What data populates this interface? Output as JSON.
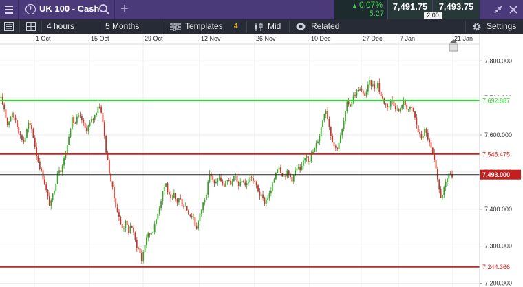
{
  "header": {
    "instrument_number": "1",
    "instrument_name": "UK 100 - Cash",
    "change_percent": "0.07%",
    "change_points": "5.27",
    "sell_price": "7,491.75",
    "buy_price": "7,493.75",
    "spread": "2.00",
    "colors": {
      "bar": "#4a3a7a",
      "change_up": "#3ed14a"
    }
  },
  "toolbar": {
    "interval": "4 hours",
    "range": "5 Months",
    "templates_label": "Templates",
    "templates_count": "4",
    "price_type": "Mid",
    "related_label": "Related",
    "settings_label": "Settings"
  },
  "chart_data": {
    "type": "candlestick",
    "x_ticks": [
      "1 Oct",
      "15 Oct",
      "29 Oct",
      "12 Nov",
      "26 Nov",
      "10 Dec",
      "27 Dec",
      "7 Jan",
      "21 Jan"
    ],
    "y_ticks": [
      "7,800.000",
      "7,700.000",
      "7,600.000",
      "7,500.000",
      "7,400.000",
      "7,300.000",
      "7,200.000"
    ],
    "ylim": [
      7190,
      7845
    ],
    "up_color": "#3aa12a",
    "down_color": "#c0392b",
    "levels": [
      {
        "label": "7,692.887",
        "value": 7692.887,
        "color": "#22e022"
      },
      {
        "label": "7,548.475",
        "value": 7548.475,
        "color": "#d11f1f"
      },
      {
        "label": "7,493.000",
        "value": 7493.0,
        "color": "#222222"
      },
      {
        "label": "7,244.366",
        "value": 7244.366,
        "color": "#d11f1f"
      }
    ],
    "price_path": [
      [
        0,
        7700
      ],
      [
        5,
        7672
      ],
      [
        10,
        7628
      ],
      [
        16,
        7658
      ],
      [
        22,
        7640
      ],
      [
        28,
        7600
      ],
      [
        34,
        7580
      ],
      [
        40,
        7630
      ],
      [
        46,
        7612
      ],
      [
        52,
        7548
      ],
      [
        58,
        7508
      ],
      [
        63,
        7478
      ],
      [
        68,
        7435
      ],
      [
        72,
        7405
      ],
      [
        76,
        7440
      ],
      [
        80,
        7470
      ],
      [
        84,
        7512
      ],
      [
        88,
        7505
      ],
      [
        92,
        7535
      ],
      [
        96,
        7560
      ],
      [
        100,
        7612
      ],
      [
        104,
        7642
      ],
      [
        108,
        7628
      ],
      [
        112,
        7650
      ],
      [
        118,
        7640
      ],
      [
        124,
        7612
      ],
      [
        130,
        7632
      ],
      [
        136,
        7648
      ],
      [
        142,
        7680
      ],
      [
        146,
        7668
      ],
      [
        150,
        7612
      ],
      [
        154,
        7545
      ],
      [
        158,
        7500
      ],
      [
        162,
        7460
      ],
      [
        166,
        7420
      ],
      [
        170,
        7392
      ],
      [
        174,
        7362
      ],
      [
        178,
        7348
      ],
      [
        182,
        7365
      ],
      [
        186,
        7340
      ],
      [
        190,
        7360
      ],
      [
        194,
        7325
      ],
      [
        198,
        7300
      ],
      [
        202,
        7288
      ],
      [
        205,
        7262
      ],
      [
        208,
        7292
      ],
      [
        212,
        7325
      ],
      [
        216,
        7332
      ],
      [
        220,
        7340
      ],
      [
        224,
        7355
      ],
      [
        228,
        7390
      ],
      [
        232,
        7415
      ],
      [
        236,
        7455
      ],
      [
        240,
        7470
      ],
      [
        244,
        7438
      ],
      [
        248,
        7420
      ],
      [
        252,
        7438
      ],
      [
        256,
        7418
      ],
      [
        260,
        7432
      ],
      [
        264,
        7412
      ],
      [
        268,
        7410
      ],
      [
        272,
        7395
      ],
      [
        276,
        7382
      ],
      [
        280,
        7380
      ],
      [
        284,
        7345
      ],
      [
        288,
        7372
      ],
      [
        292,
        7400
      ],
      [
        296,
        7428
      ],
      [
        300,
        7452
      ],
      [
        304,
        7502
      ],
      [
        308,
        7478
      ],
      [
        312,
        7462
      ],
      [
        316,
        7488
      ],
      [
        320,
        7478
      ],
      [
        324,
        7458
      ],
      [
        328,
        7482
      ],
      [
        332,
        7470
      ],
      [
        336,
        7470
      ],
      [
        340,
        7490
      ],
      [
        344,
        7470
      ],
      [
        348,
        7466
      ],
      [
        352,
        7480
      ],
      [
        356,
        7462
      ],
      [
        360,
        7475
      ],
      [
        364,
        7490
      ],
      [
        368,
        7472
      ],
      [
        372,
        7462
      ],
      [
        376,
        7440
      ],
      [
        380,
        7430
      ],
      [
        384,
        7418
      ],
      [
        388,
        7432
      ],
      [
        392,
        7442
      ],
      [
        396,
        7470
      ],
      [
        400,
        7500
      ],
      [
        404,
        7520
      ],
      [
        408,
        7498
      ],
      [
        412,
        7488
      ],
      [
        416,
        7500
      ],
      [
        420,
        7490
      ],
      [
        424,
        7480
      ],
      [
        428,
        7502
      ],
      [
        432,
        7512
      ],
      [
        436,
        7498
      ],
      [
        440,
        7530
      ],
      [
        444,
        7550
      ],
      [
        448,
        7528
      ],
      [
        452,
        7548
      ],
      [
        456,
        7560
      ],
      [
        460,
        7580
      ],
      [
        464,
        7605
      ],
      [
        468,
        7640
      ],
      [
        472,
        7676
      ],
      [
        476,
        7640
      ],
      [
        480,
        7600
      ],
      [
        484,
        7575
      ],
      [
        488,
        7560
      ],
      [
        492,
        7582
      ],
      [
        496,
        7610
      ],
      [
        500,
        7648
      ],
      [
        504,
        7690
      ],
      [
        508,
        7680
      ],
      [
        512,
        7702
      ],
      [
        516,
        7712
      ],
      [
        520,
        7725
      ],
      [
        524,
        7718
      ],
      [
        528,
        7705
      ],
      [
        532,
        7720
      ],
      [
        536,
        7742
      ],
      [
        540,
        7735
      ],
      [
        544,
        7728
      ],
      [
        548,
        7740
      ],
      [
        552,
        7708
      ],
      [
        556,
        7692
      ],
      [
        560,
        7682
      ],
      [
        564,
        7676
      ],
      [
        568,
        7698
      ],
      [
        572,
        7682
      ],
      [
        576,
        7668
      ],
      [
        580,
        7660
      ],
      [
        584,
        7690
      ],
      [
        588,
        7682
      ],
      [
        592,
        7668
      ],
      [
        596,
        7672
      ],
      [
        600,
        7662
      ],
      [
        604,
        7630
      ],
      [
        608,
        7600
      ],
      [
        612,
        7592
      ],
      [
        616,
        7612
      ],
      [
        620,
        7598
      ],
      [
        624,
        7570
      ],
      [
        628,
        7548
      ],
      [
        632,
        7510
      ],
      [
        636,
        7462
      ],
      [
        640,
        7432
      ],
      [
        644,
        7452
      ],
      [
        648,
        7472
      ],
      [
        652,
        7502
      ],
      [
        656,
        7485
      ],
      [
        658,
        7493
      ]
    ]
  }
}
